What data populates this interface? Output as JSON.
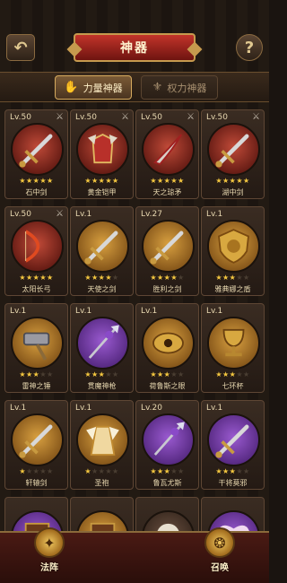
{
  "header": {
    "title": "神器",
    "back_label": "↶",
    "help_label": "?"
  },
  "tabs": [
    {
      "label": "力量神器",
      "icon": "✋",
      "active": true
    },
    {
      "label": "权力神器",
      "icon": "⚜",
      "active": false
    }
  ],
  "artifacts": [
    {
      "level": "Lv.50",
      "name": "石中剑",
      "stars": 5,
      "locked": true,
      "bg": "red",
      "icon": "sword"
    },
    {
      "level": "Lv.50",
      "name": "黄金铠甲",
      "stars": 5,
      "locked": true,
      "bg": "red",
      "icon": "armor"
    },
    {
      "level": "Lv.50",
      "name": "天之琼矛",
      "stars": 5,
      "locked": true,
      "bg": "red",
      "icon": "blade"
    },
    {
      "level": "Lv.50",
      "name": "湖中剑",
      "stars": 5,
      "locked": true,
      "bg": "red",
      "icon": "sword"
    },
    {
      "level": "Lv.50",
      "name": "太阳长弓",
      "stars": 5,
      "locked": true,
      "bg": "red",
      "icon": "bow"
    },
    {
      "level": "Lv.1",
      "name": "天使之剑",
      "stars": 4,
      "locked": false,
      "bg": "gold",
      "icon": "sword"
    },
    {
      "level": "Lv.27",
      "name": "胜利之剑",
      "stars": 4,
      "locked": false,
      "bg": "gold",
      "icon": "sword"
    },
    {
      "level": "Lv.1",
      "name": "雅典娜之盾",
      "stars": 3,
      "locked": false,
      "bg": "gold",
      "icon": "shield"
    },
    {
      "level": "Lv.1",
      "name": "雷神之锤",
      "stars": 3,
      "locked": false,
      "bg": "gold",
      "icon": "hammer"
    },
    {
      "level": "Lv.1",
      "name": "贯魔神枪",
      "stars": 3,
      "locked": false,
      "bg": "purple",
      "icon": "spear"
    },
    {
      "level": "Lv.1",
      "name": "荷鲁斯之眼",
      "stars": 3,
      "locked": false,
      "bg": "gold",
      "icon": "eye"
    },
    {
      "level": "Lv.1",
      "name": "七环杯",
      "stars": 3,
      "locked": false,
      "bg": "gold",
      "icon": "cup"
    },
    {
      "level": "Lv.1",
      "name": "轩辕剑",
      "stars": 1,
      "locked": false,
      "bg": "gold",
      "icon": "sword"
    },
    {
      "level": "Lv.1",
      "name": "圣袍",
      "stars": 1,
      "locked": false,
      "bg": "gold",
      "icon": "robe"
    },
    {
      "level": "Lv.20",
      "name": "鲁瓦尤斯",
      "stars": 3,
      "locked": false,
      "bg": "purple",
      "icon": "spear"
    },
    {
      "level": "Lv.1",
      "name": "干将莫邪",
      "stars": 3,
      "locked": false,
      "bg": "purple",
      "icon": "sword"
    },
    {
      "level": "",
      "name": "",
      "stars": 0,
      "locked": false,
      "bg": "purple",
      "icon": "book"
    },
    {
      "level": "",
      "name": "",
      "stars": 0,
      "locked": false,
      "bg": "gold",
      "icon": "book"
    },
    {
      "level": "",
      "name": "",
      "stars": 0,
      "locked": false,
      "bg": "dark",
      "icon": "skull"
    },
    {
      "level": "",
      "name": "",
      "stars": 0,
      "locked": false,
      "bg": "purple",
      "icon": "wings"
    }
  ],
  "lock_icon": "⚔",
  "star_char": "★",
  "bottom_nav": [
    {
      "label": "法阵",
      "icon": "✦"
    },
    {
      "label": "召唤",
      "icon": "❂"
    }
  ]
}
